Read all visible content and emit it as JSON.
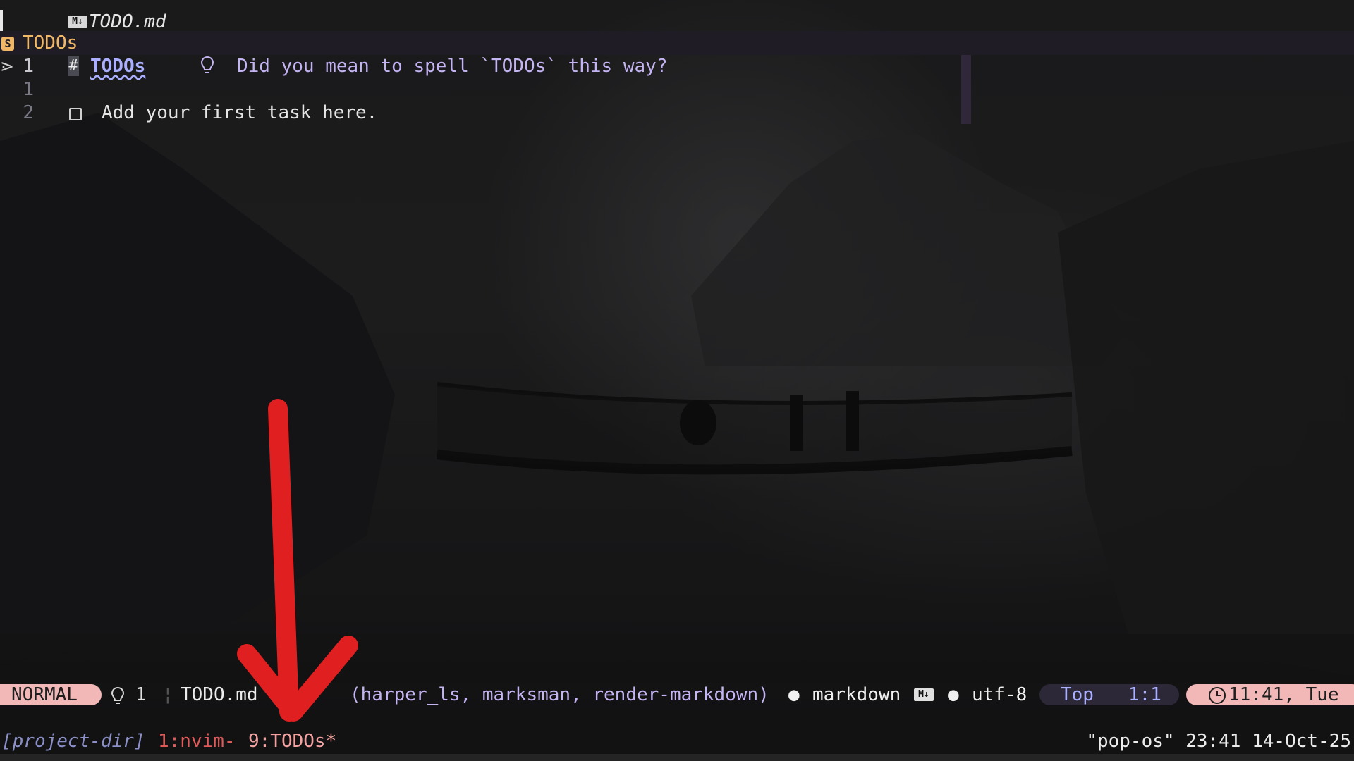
{
  "tabline": {
    "file_badge": "M↓",
    "file_name": "TODO.md"
  },
  "winbar": {
    "symbol_badge": "S",
    "breadcrumb": "TODOs"
  },
  "editor": {
    "lines": [
      {
        "sign": "⋗",
        "number": "1",
        "hash": "#",
        "heading": "TODOs",
        "diagnostic": "Did you mean to spell `TODOs` this way?"
      },
      {
        "number": "1"
      },
      {
        "number": "2",
        "task": "Add your first task here."
      }
    ]
  },
  "statusline": {
    "mode": "NORMAL",
    "diagnostic_count": "1",
    "separator": "¦",
    "file": "TODO.md",
    "lsp_clients": "(harper_ls, marksman, render-markdown)",
    "dot": "●",
    "filetype": "markdown",
    "filetype_badge": "M↓",
    "encoding": "utf-8",
    "scroll": "Top",
    "cursor_pos": "1:1",
    "clock": "11:41, Tue"
  },
  "tmux": {
    "session": "[project-dir]",
    "window1": "1:nvim-",
    "window9": "9:TODOs*",
    "right": "\"pop-os\" 23:41 14-Oct-25"
  },
  "colors": {
    "accent_pink": "#f2b8b8",
    "heading": "#aab0ff",
    "diagnostic": "#c5b4f2",
    "breadcrumb": "#f0b866",
    "arrow": "#e02020"
  }
}
